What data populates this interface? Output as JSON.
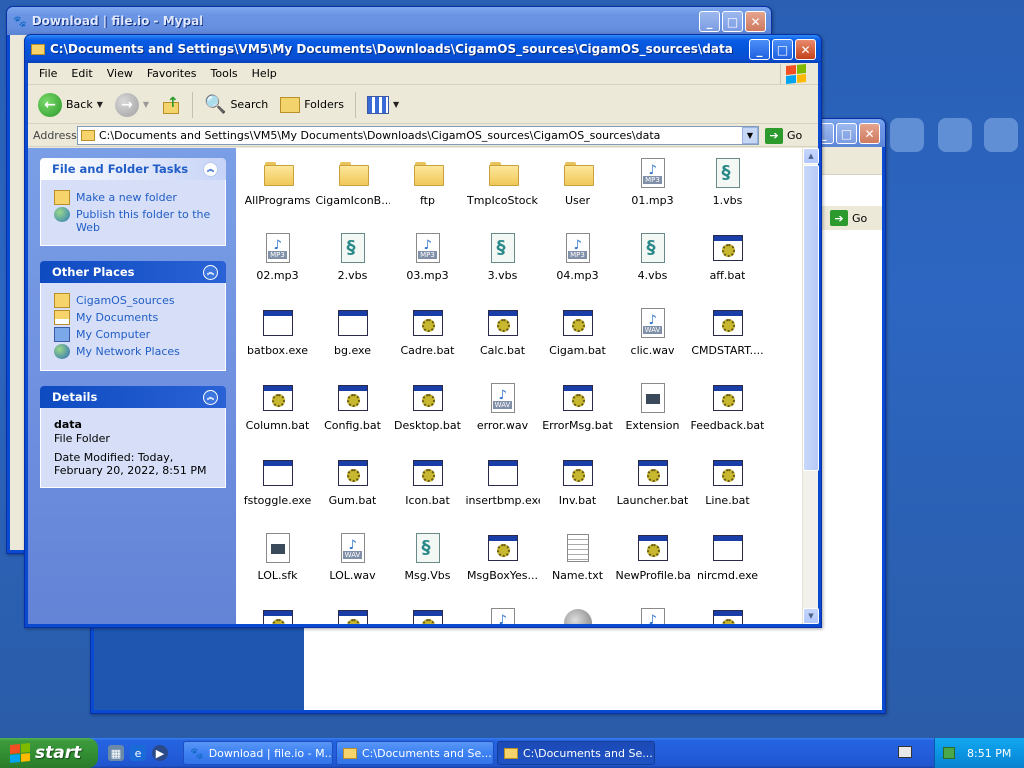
{
  "back_window": {
    "title": "Download | file.io - Mypal"
  },
  "right_window": {
    "go_label": "Go"
  },
  "main_window": {
    "title": "C:\\Documents and Settings\\VM5\\My Documents\\Downloads\\CigamOS_sources\\CigamOS_sources\\data",
    "menu": [
      "File",
      "Edit",
      "View",
      "Favorites",
      "Tools",
      "Help"
    ],
    "toolbar": {
      "back_label": "Back",
      "search_label": "Search",
      "folders_label": "Folders"
    },
    "address": {
      "label": "Address",
      "value": "C:\\Documents and Settings\\VM5\\My Documents\\Downloads\\CigamOS_sources\\CigamOS_sources\\data",
      "go_label": "Go"
    }
  },
  "taskpane": {
    "file_tasks": {
      "title": "File and Folder Tasks",
      "links": [
        "Make a new folder",
        "Publish this folder to the Web"
      ]
    },
    "other_places": {
      "title": "Other Places",
      "links": [
        "CigamOS_sources",
        "My Documents",
        "My Computer",
        "My Network Places"
      ]
    },
    "details": {
      "title": "Details",
      "name": "data",
      "type": "File Folder",
      "modified": "Date Modified: Today, February 20, 2022, 8:51 PM"
    }
  },
  "files": [
    {
      "name": "AllPrograms",
      "icon": "folder"
    },
    {
      "name": "CigamIconB...",
      "icon": "folder"
    },
    {
      "name": "ftp",
      "icon": "folder"
    },
    {
      "name": "TmpIcoStock",
      "icon": "folder"
    },
    {
      "name": "User",
      "icon": "folder"
    },
    {
      "name": "01.mp3",
      "icon": "mp3"
    },
    {
      "name": "1.vbs",
      "icon": "vbs"
    },
    {
      "name": "02.mp3",
      "icon": "mp3"
    },
    {
      "name": "2.vbs",
      "icon": "vbs"
    },
    {
      "name": "03.mp3",
      "icon": "mp3"
    },
    {
      "name": "3.vbs",
      "icon": "vbs"
    },
    {
      "name": "04.mp3",
      "icon": "mp3"
    },
    {
      "name": "4.vbs",
      "icon": "vbs"
    },
    {
      "name": "aff.bat",
      "icon": "bat"
    },
    {
      "name": "batbox.exe",
      "icon": "exe"
    },
    {
      "name": "bg.exe",
      "icon": "exe"
    },
    {
      "name": "Cadre.bat",
      "icon": "bat"
    },
    {
      "name": "Calc.bat",
      "icon": "bat"
    },
    {
      "name": "Cigam.bat",
      "icon": "bat"
    },
    {
      "name": "clic.wav",
      "icon": "wav"
    },
    {
      "name": "CMDSTART....",
      "icon": "bat"
    },
    {
      "name": "Column.bat",
      "icon": "bat"
    },
    {
      "name": "Config.bat",
      "icon": "bat"
    },
    {
      "name": "Desktop.bat",
      "icon": "bat"
    },
    {
      "name": "error.wav",
      "icon": "wav"
    },
    {
      "name": "ErrorMsg.bat",
      "icon": "bat"
    },
    {
      "name": "Extension",
      "icon": "sfk"
    },
    {
      "name": "Feedback.bat",
      "icon": "bat"
    },
    {
      "name": "fstoggle.exe",
      "icon": "exe"
    },
    {
      "name": "Gum.bat",
      "icon": "bat"
    },
    {
      "name": "Icon.bat",
      "icon": "bat"
    },
    {
      "name": "insertbmp.exe",
      "icon": "exe"
    },
    {
      "name": "Inv.bat",
      "icon": "bat"
    },
    {
      "name": "Launcher.bat",
      "icon": "bat"
    },
    {
      "name": "Line.bat",
      "icon": "bat"
    },
    {
      "name": "LOL.sfk",
      "icon": "sfk"
    },
    {
      "name": "LOL.wav",
      "icon": "wav"
    },
    {
      "name": "Msg.Vbs",
      "icon": "vbs"
    },
    {
      "name": "MsgBoxYes...",
      "icon": "bat"
    },
    {
      "name": "Name.txt",
      "icon": "txt"
    },
    {
      "name": "NewProfile.bat",
      "icon": "bat"
    },
    {
      "name": "nircmd.exe",
      "icon": "exe"
    },
    {
      "name": "",
      "icon": "bat"
    },
    {
      "name": "",
      "icon": "bat"
    },
    {
      "name": "",
      "icon": "bat"
    },
    {
      "name": "",
      "icon": "wav"
    },
    {
      "name": "",
      "icon": "speaker"
    },
    {
      "name": "",
      "icon": "wav"
    },
    {
      "name": "",
      "icon": "bat"
    }
  ],
  "taskbar": {
    "start_label": "start",
    "buttons": [
      {
        "label": "Download | file.io - M...",
        "active": false
      },
      {
        "label": "C:\\Documents and Se...",
        "active": false
      },
      {
        "label": "C:\\Documents and Se...",
        "active": true
      }
    ],
    "clock": "8:51 PM"
  }
}
